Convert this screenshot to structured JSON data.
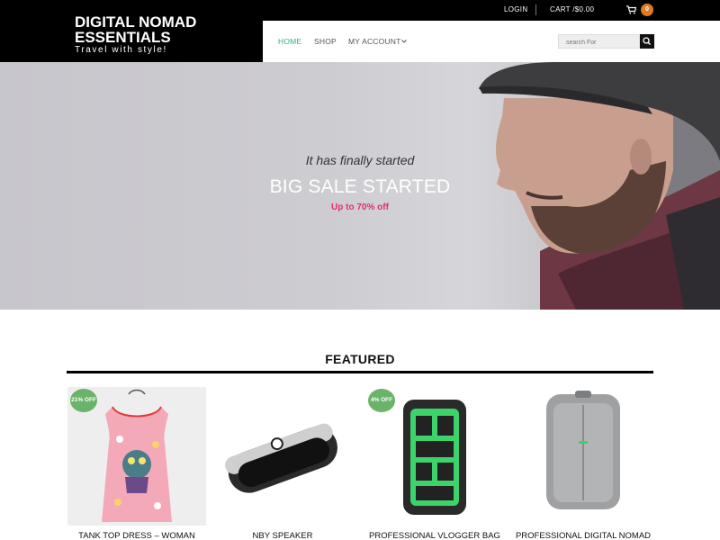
{
  "header": {
    "logo_title": "DIGITAL NOMAD ESSENTIALS",
    "logo_tagline": "Travel with style!",
    "login_label": "LOGIN",
    "cart_label": "CART /$0.00",
    "cart_count": "0"
  },
  "nav": {
    "items": [
      {
        "label": "HOME",
        "active": true
      },
      {
        "label": "SHOP",
        "active": false
      },
      {
        "label": "MY ACCOUNT",
        "active": false
      }
    ],
    "search_placeholder": "search For"
  },
  "hero": {
    "kicker": "It has finally started",
    "title": "BIG SALE STARTED",
    "subtitle": "Up to 70% off"
  },
  "featured": {
    "title": "FEATURED",
    "products": [
      {
        "name": "TANK TOP DRESS – WOMAN",
        "badge": "21% OFF"
      },
      {
        "name": "NBY SPEAKER",
        "badge": ""
      },
      {
        "name": "PROFESSIONAL VLOGGER BAG",
        "badge": "4% OFF"
      },
      {
        "name": "PROFESSIONAL DIGITAL NOMAD",
        "badge": ""
      }
    ]
  },
  "colors": {
    "accent_green": "#2bb08a",
    "badge_green": "#6bb36a",
    "cart_orange": "#e0791f",
    "sale_pink": "#e0306e"
  },
  "icons": [
    "cart-icon",
    "search-icon",
    "chevron-down-icon"
  ]
}
